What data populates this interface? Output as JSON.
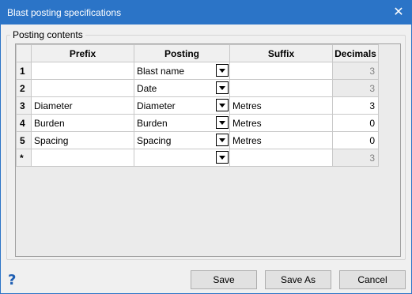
{
  "window": {
    "title": "Blast posting specifications"
  },
  "group": {
    "label": "Posting contents"
  },
  "grid": {
    "columns": [
      "Prefix",
      "Posting",
      "Suffix",
      "Decimals"
    ],
    "rows": [
      {
        "id": "1",
        "prefix": "",
        "posting": "Blast name",
        "suffix": "",
        "decimals": "3",
        "decimals_disabled": true
      },
      {
        "id": "2",
        "prefix": "",
        "posting": "Date",
        "suffix": "",
        "decimals": "3",
        "decimals_disabled": true
      },
      {
        "id": "3",
        "prefix": "Diameter",
        "posting": "Diameter",
        "suffix": "Metres",
        "decimals": "3",
        "decimals_disabled": false
      },
      {
        "id": "4",
        "prefix": "Burden",
        "posting": "Burden",
        "suffix": "Metres",
        "decimals": "0",
        "decimals_disabled": false
      },
      {
        "id": "5",
        "prefix": "Spacing",
        "posting": "Spacing",
        "suffix": "Metres",
        "decimals": "0",
        "decimals_disabled": false
      },
      {
        "id": "*",
        "prefix": "",
        "posting": "",
        "suffix": "",
        "decimals": "3",
        "decimals_disabled": true
      }
    ]
  },
  "buttons": {
    "save": "Save",
    "save_as": "Save As",
    "cancel": "Cancel"
  },
  "icons": {
    "help": "?",
    "close": "✕"
  },
  "colors": {
    "titlebar": "#2b74c7",
    "help_icon": "#1f5fb3"
  }
}
